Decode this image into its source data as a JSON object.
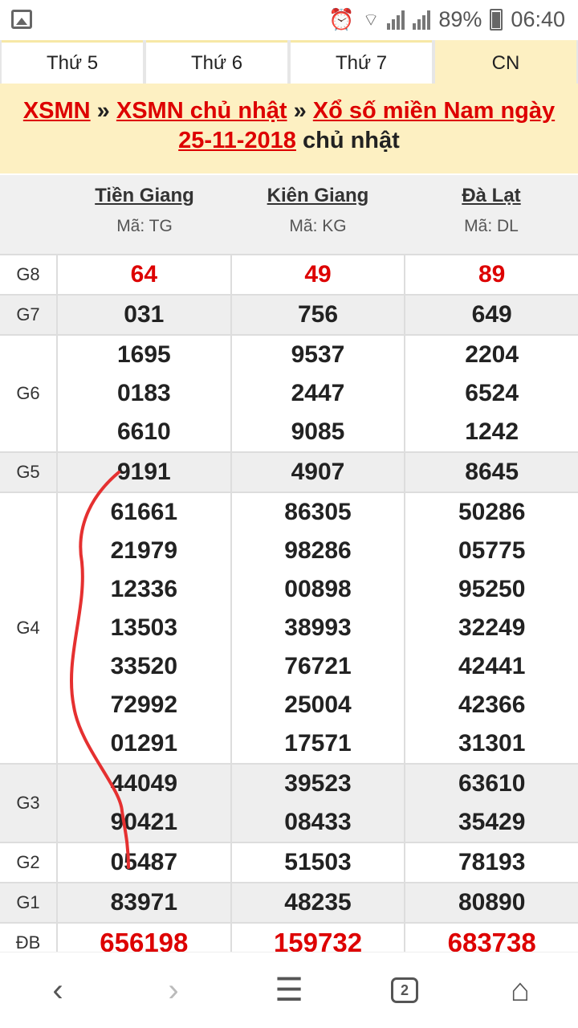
{
  "status": {
    "battery": "89%",
    "time": "06:40"
  },
  "tabs": [
    "Thứ 5",
    "Thứ 6",
    "Thứ 7",
    "CN"
  ],
  "title": {
    "link1": "XSMN",
    "sep1": " » ",
    "link2": "XSMN chủ nhật",
    "sep2": " » ",
    "link3a": "Xổ số miền Nam ngày",
    "link3b": "25-11-2018",
    "tail": " chủ nhật"
  },
  "provinces": [
    {
      "name": "Tiền Giang",
      "code": "Mã: TG"
    },
    {
      "name": "Kiên Giang",
      "code": "Mã: KG"
    },
    {
      "name": "Đà Lạt",
      "code": "Mã: DL"
    }
  ],
  "prizes": [
    {
      "label": "G8",
      "values": [
        [
          "64"
        ],
        [
          "49"
        ],
        [
          "89"
        ]
      ]
    },
    {
      "label": "G7",
      "values": [
        [
          "031"
        ],
        [
          "756"
        ],
        [
          "649"
        ]
      ]
    },
    {
      "label": "G6",
      "values": [
        [
          "1695",
          "0183",
          "6610"
        ],
        [
          "9537",
          "2447",
          "9085"
        ],
        [
          "2204",
          "6524",
          "1242"
        ]
      ]
    },
    {
      "label": "G5",
      "values": [
        [
          "9191"
        ],
        [
          "4907"
        ],
        [
          "8645"
        ]
      ]
    },
    {
      "label": "G4",
      "values": [
        [
          "61661",
          "21979",
          "12336",
          "13503",
          "33520",
          "72992",
          "01291"
        ],
        [
          "86305",
          "98286",
          "00898",
          "38993",
          "76721",
          "25004",
          "17571"
        ],
        [
          "50286",
          "05775",
          "95250",
          "32249",
          "42441",
          "42366",
          "31301"
        ]
      ]
    },
    {
      "label": "G3",
      "values": [
        [
          "44049",
          "90421"
        ],
        [
          "39523",
          "08433"
        ],
        [
          "63610",
          "35429"
        ]
      ]
    },
    {
      "label": "G2",
      "values": [
        [
          "05487"
        ],
        [
          "51503"
        ],
        [
          "78193"
        ]
      ]
    },
    {
      "label": "G1",
      "values": [
        [
          "83971"
        ],
        [
          "48235"
        ],
        [
          "80890"
        ]
      ]
    },
    {
      "label": "ĐB",
      "values": [
        [
          "656198"
        ],
        [
          "159732"
        ],
        [
          "683738"
        ]
      ]
    }
  ],
  "nav": {
    "tabs_count": "2"
  }
}
